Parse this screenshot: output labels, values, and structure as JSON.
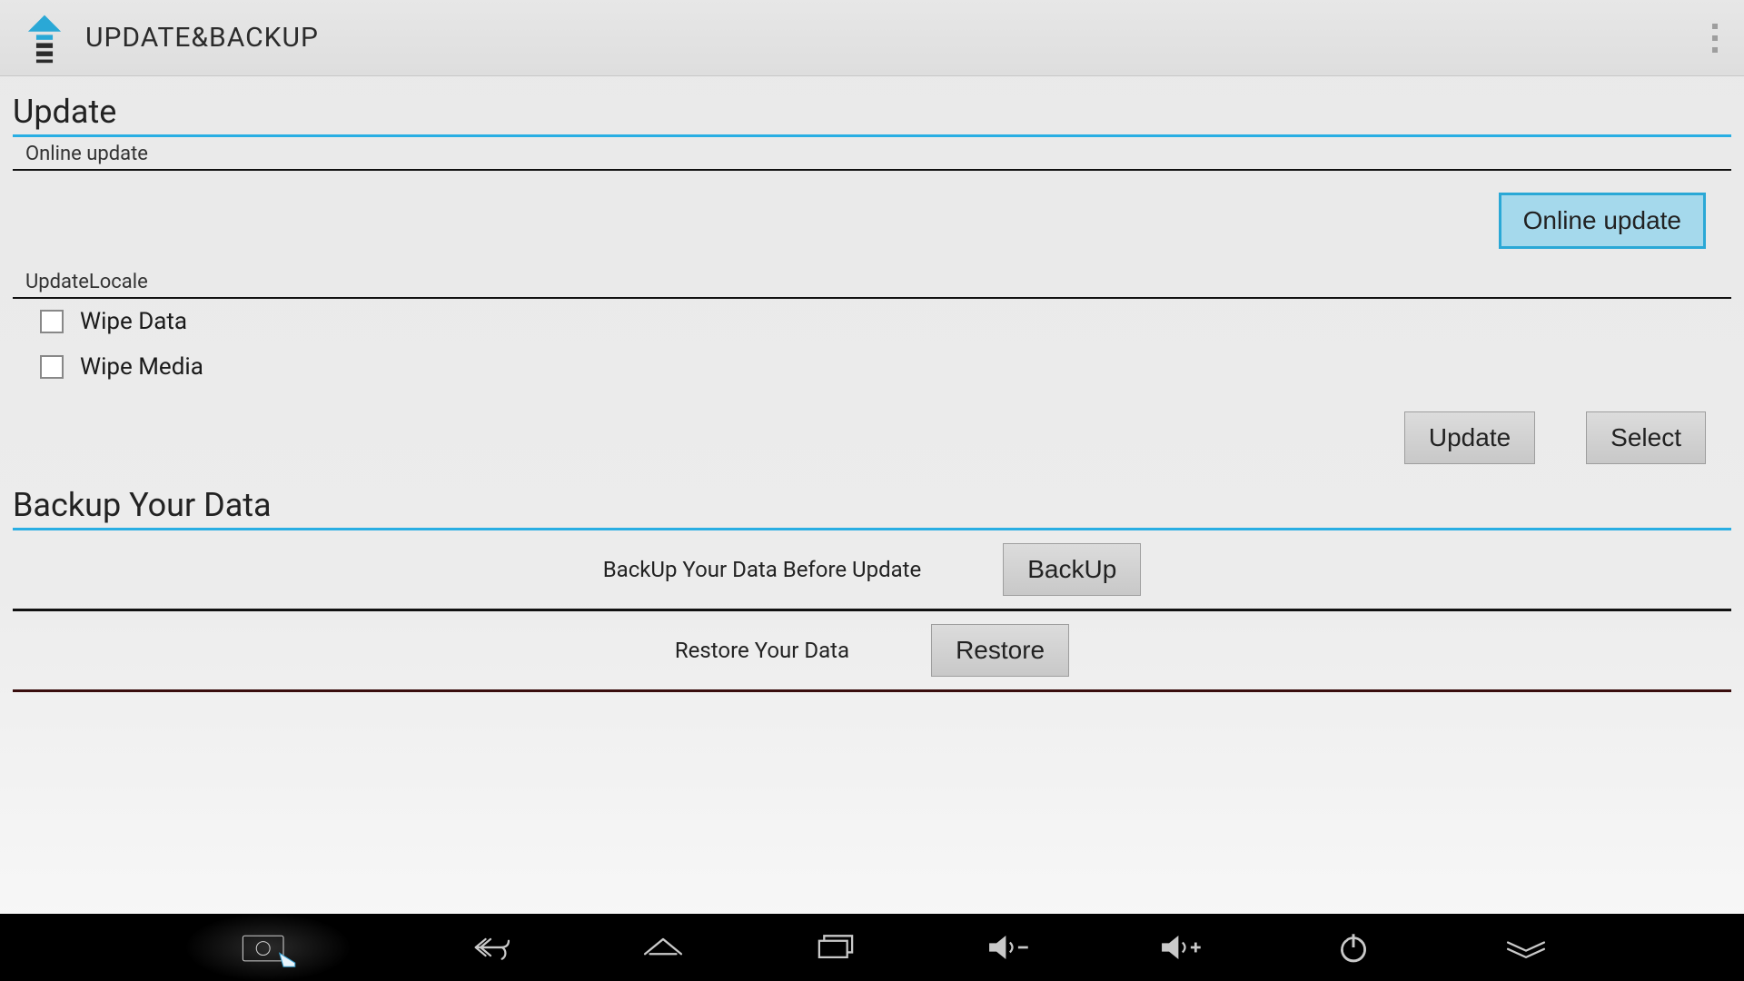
{
  "appbar": {
    "title": "UPDATE&BACKUP"
  },
  "update": {
    "heading": "Update",
    "online": {
      "subheader": "Online update",
      "button": "Online update"
    },
    "locale": {
      "subheader": "UpdateLocale",
      "wipe_data_label": "Wipe Data",
      "wipe_media_label": "Wipe Media",
      "update_button": "Update",
      "select_button": "Select"
    }
  },
  "backup": {
    "heading": "Backup Your Data",
    "rows": [
      {
        "label": "BackUp Your Data Before Update",
        "button": "BackUp"
      },
      {
        "label": "Restore Your Data",
        "button": "Restore"
      }
    ]
  }
}
